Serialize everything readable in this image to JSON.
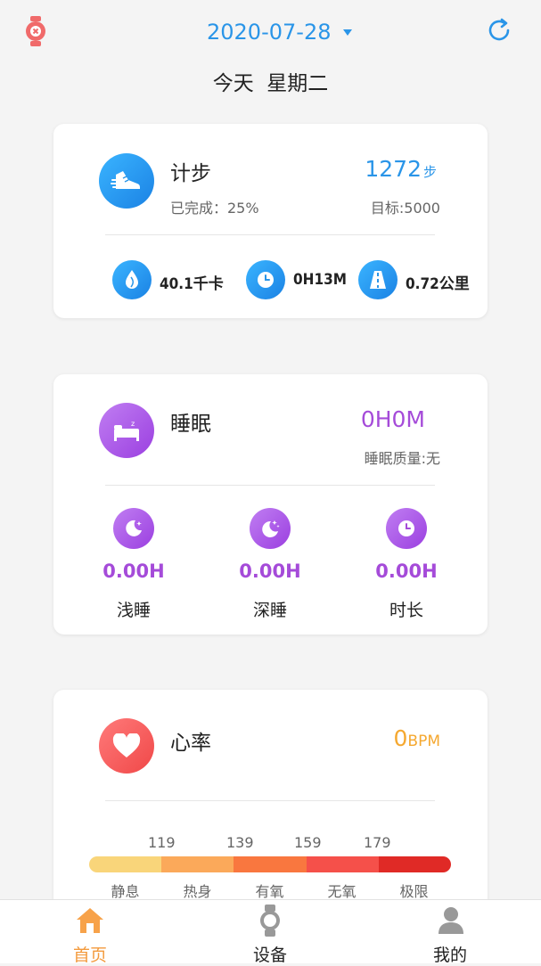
{
  "header": {
    "date": "2020-07-28",
    "day_label": "今天  星期二"
  },
  "steps": {
    "title": "计步",
    "completed": "已完成：25%",
    "value": "1272",
    "unit": "步",
    "target": "目标:5000",
    "calories": "40.1千卡",
    "duration": "0H13M",
    "distance": "0.72公里",
    "accent": "#2a95e8"
  },
  "sleep": {
    "title": "睡眠",
    "value": "0H0M",
    "quality": "睡眠质量:无",
    "light_value": "0.00H",
    "light_label": "浅睡",
    "deep_value": "0.00H",
    "deep_label": "深睡",
    "total_value": "0.00H",
    "total_label": "时长",
    "accent": "#a54bd9"
  },
  "heart": {
    "title": "心率",
    "value": "0",
    "unit": "BPM",
    "accent": "#f5a830",
    "thresholds": [
      "119",
      "139",
      "159",
      "179"
    ],
    "zones": [
      "静息",
      "热身",
      "有氧",
      "无氧",
      "极限"
    ],
    "zone_colors": [
      "#f9d57a",
      "#fba95a",
      "#f9773f",
      "#f5504a",
      "#e02a26"
    ]
  },
  "nav": {
    "home": "首页",
    "device": "设备",
    "mine": "我的",
    "active": "home"
  }
}
